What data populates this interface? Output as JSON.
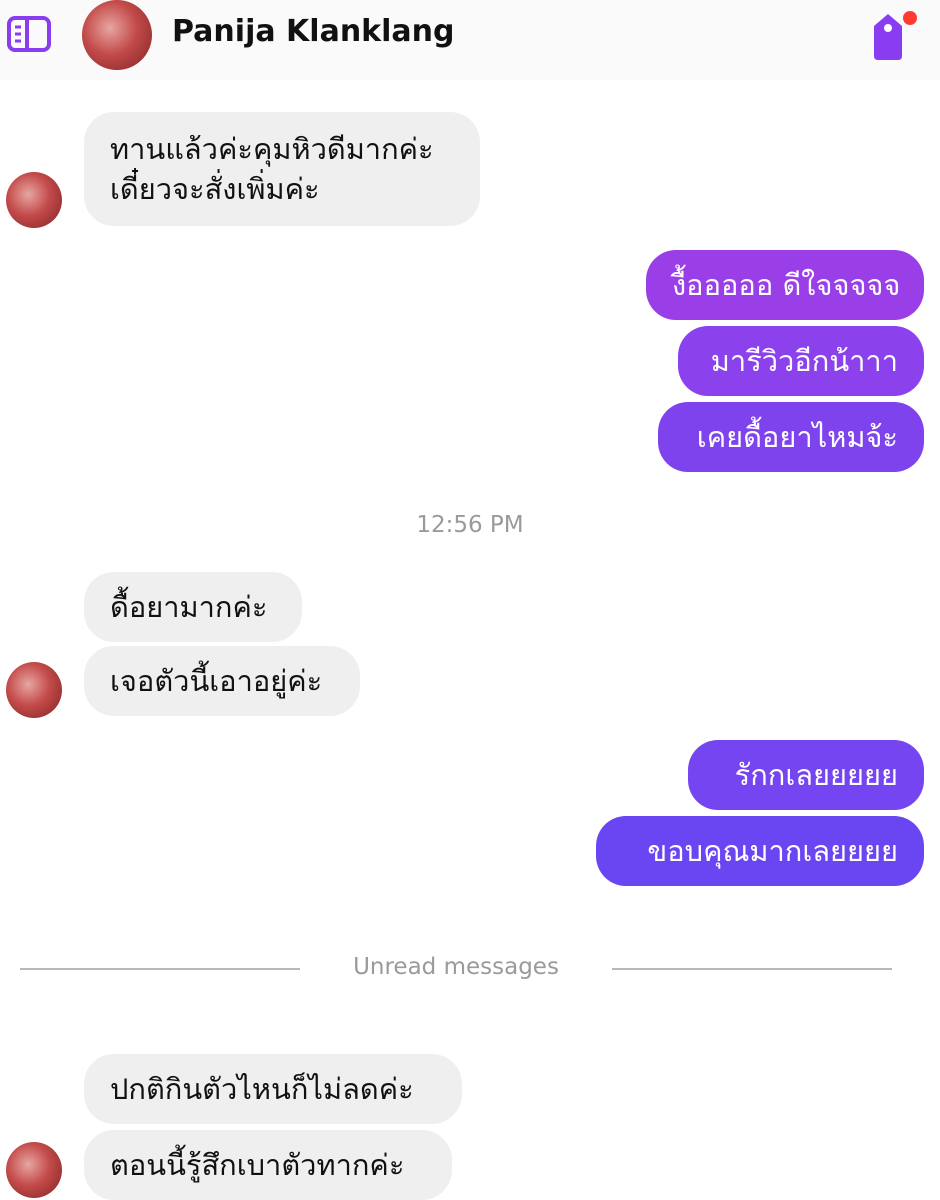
{
  "header": {
    "contact_name": "Panija Klanklang"
  },
  "colors": {
    "accent": "#8a3cf0",
    "outgoing_top": "#9b3fe9",
    "outgoing_bottom": "#6c45f2",
    "incoming": "#efefef",
    "notification_dot": "#ff3b30"
  },
  "messages": {
    "m1": "ทานแล้วค่ะคุมหิวดีมากค่ะ",
    "m1b": "เดี๋ยวจะสั่งเพิ่มค่ะ",
    "m2": "งื้อออออ ดีใจจจจจ",
    "m3": "มารีวิวอีกน้าาา",
    "m4": "เคยดื้อยาไหมจ้ะ",
    "m5": "ดื้อยามากค่ะ",
    "m6": "เจอตัวนี้เอาอยู่ค่ะ",
    "m7": "รักกเลยยยยย",
    "m8": "ขอบคุณมากเลยยยย",
    "m9": "ปกติกินตัวไหนก็ไม่ลดค่ะ",
    "m10": "ตอนนี้รู้สึกเบาตัวทากค่ะ"
  },
  "timestamp": "12:56 PM",
  "unread_label": "Unread messages",
  "icons": {
    "sidebar": "sidebar-toggle-icon",
    "tag": "tag-icon"
  }
}
